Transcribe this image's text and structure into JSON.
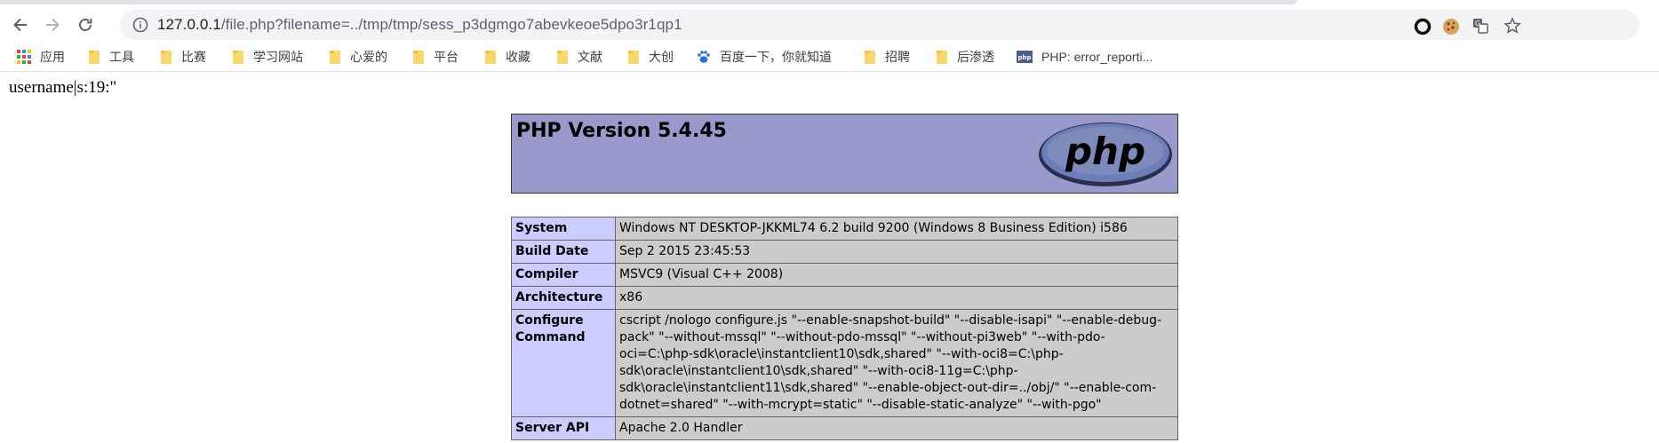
{
  "browser": {
    "url_host": "127.0.0.1",
    "url_path": "/file.php?filename=../tmp/tmp/sess_p3dgmgo7abevkeoe5dpo3r1qp1",
    "bookmarks": [
      {
        "label": "应用",
        "icon": "apps-grid-icon"
      },
      {
        "label": "工具",
        "icon": "folder-icon"
      },
      {
        "label": "比赛",
        "icon": "folder-icon"
      },
      {
        "label": "学习网站",
        "icon": "folder-icon"
      },
      {
        "label": "心爱的",
        "icon": "folder-icon"
      },
      {
        "label": "平台",
        "icon": "folder-icon"
      },
      {
        "label": "收藏",
        "icon": "folder-icon"
      },
      {
        "label": "文献",
        "icon": "folder-icon"
      },
      {
        "label": "大创",
        "icon": "folder-icon"
      },
      {
        "label": "百度一下，你就知道",
        "icon": "baidu-paw-icon"
      },
      {
        "label": "招聘",
        "icon": "folder-icon"
      },
      {
        "label": "后渗透",
        "icon": "folder-icon"
      },
      {
        "label": "PHP: error_reporti...",
        "icon": "php-favicon-icon"
      }
    ]
  },
  "page": {
    "session_text": "username|s:19:\"",
    "php_version": "PHP Version 5.4.45",
    "logo_text": "php",
    "rows": [
      {
        "label": "System",
        "value": "Windows NT DESKTOP-JKKML74 6.2 build 9200 (Windows 8 Business Edition) i586"
      },
      {
        "label": "Build Date",
        "value": "Sep 2 2015 23:45:53"
      },
      {
        "label": "Compiler",
        "value": "MSVC9 (Visual C++ 2008)"
      },
      {
        "label": "Architecture",
        "value": "x86"
      },
      {
        "label": "Configure Command",
        "value": "cscript /nologo configure.js \"--enable-snapshot-build\" \"--disable-isapi\" \"--enable-debug-pack\" \"--without-mssql\" \"--without-pdo-mssql\" \"--without-pi3web\" \"--with-pdo-oci=C:\\php-sdk\\oracle\\instantclient10\\sdk,shared\" \"--with-oci8=C:\\php-sdk\\oracle\\instantclient10\\sdk,shared\" \"--with-oci8-11g=C:\\php-sdk\\oracle\\instantclient11\\sdk,shared\" \"--enable-object-out-dir=../obj/\" \"--enable-com-dotnet=shared\" \"--with-mcrypt=static\" \"--disable-static-analyze\" \"--with-pgo\""
      },
      {
        "label": "Server API",
        "value": "Apache 2.0 Handler"
      }
    ]
  }
}
